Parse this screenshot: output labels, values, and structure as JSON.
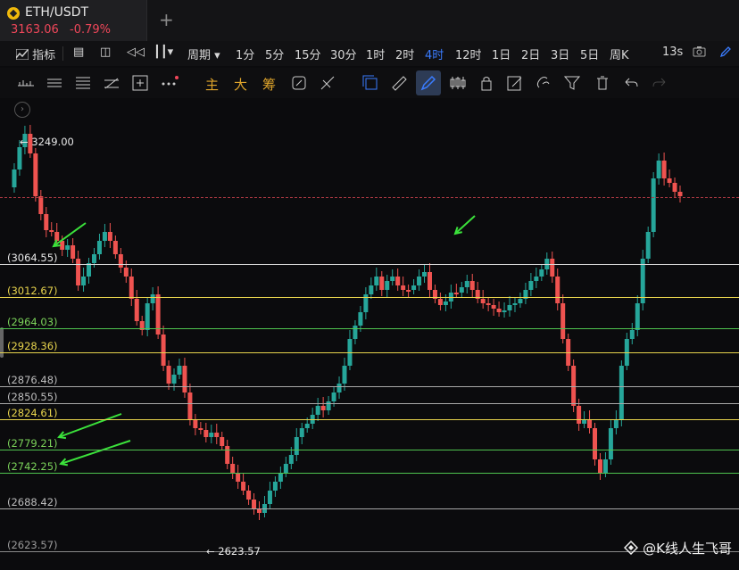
{
  "tab": {
    "symbol": "ETH/USDT",
    "price": "3163.06",
    "change": "-0.79%",
    "add": "+"
  },
  "toolbar": {
    "indicators": "指标",
    "period": "周期",
    "timeframes": [
      "1分",
      "5分",
      "15分",
      "30分",
      "1时",
      "2时",
      "4时",
      "12时",
      "1日",
      "2日",
      "3日",
      "5日",
      "周K"
    ],
    "active_timeframe": "4时",
    "countdown": "13s"
  },
  "drawing_toolbar": {
    "main": "主",
    "big": "大",
    "chips": "筹"
  },
  "chart": {
    "high_marker": "3249.00",
    "low_marker": "2623.57",
    "levels": [
      {
        "label": "(3064.55)",
        "color": "#e8e8e8"
      },
      {
        "label": "(3012.67)",
        "color": "#e8d44d"
      },
      {
        "label": "(2964.03)",
        "color": "#7bd35a"
      },
      {
        "label": "(2928.36)",
        "color": "#e8d44d"
      },
      {
        "label": "(2876.48)",
        "color": "#bdbdbd"
      },
      {
        "label": "(2850.55)",
        "color": "#bdbdbd"
      },
      {
        "label": "(2824.61)",
        "color": "#e8d44d"
      },
      {
        "label": "(2779.21)",
        "color": "#7bd35a"
      },
      {
        "label": "(2742.25)",
        "color": "#7bd35a"
      },
      {
        "label": "(2688.42)",
        "color": "#bdbdbd"
      },
      {
        "label": "(2623.57)",
        "color": "#9a9a9a"
      }
    ],
    "up_color": "#26a69a",
    "down_color": "#ef5350",
    "arrow_color": "#3be23b"
  },
  "watermark": "@K线人生飞哥"
}
